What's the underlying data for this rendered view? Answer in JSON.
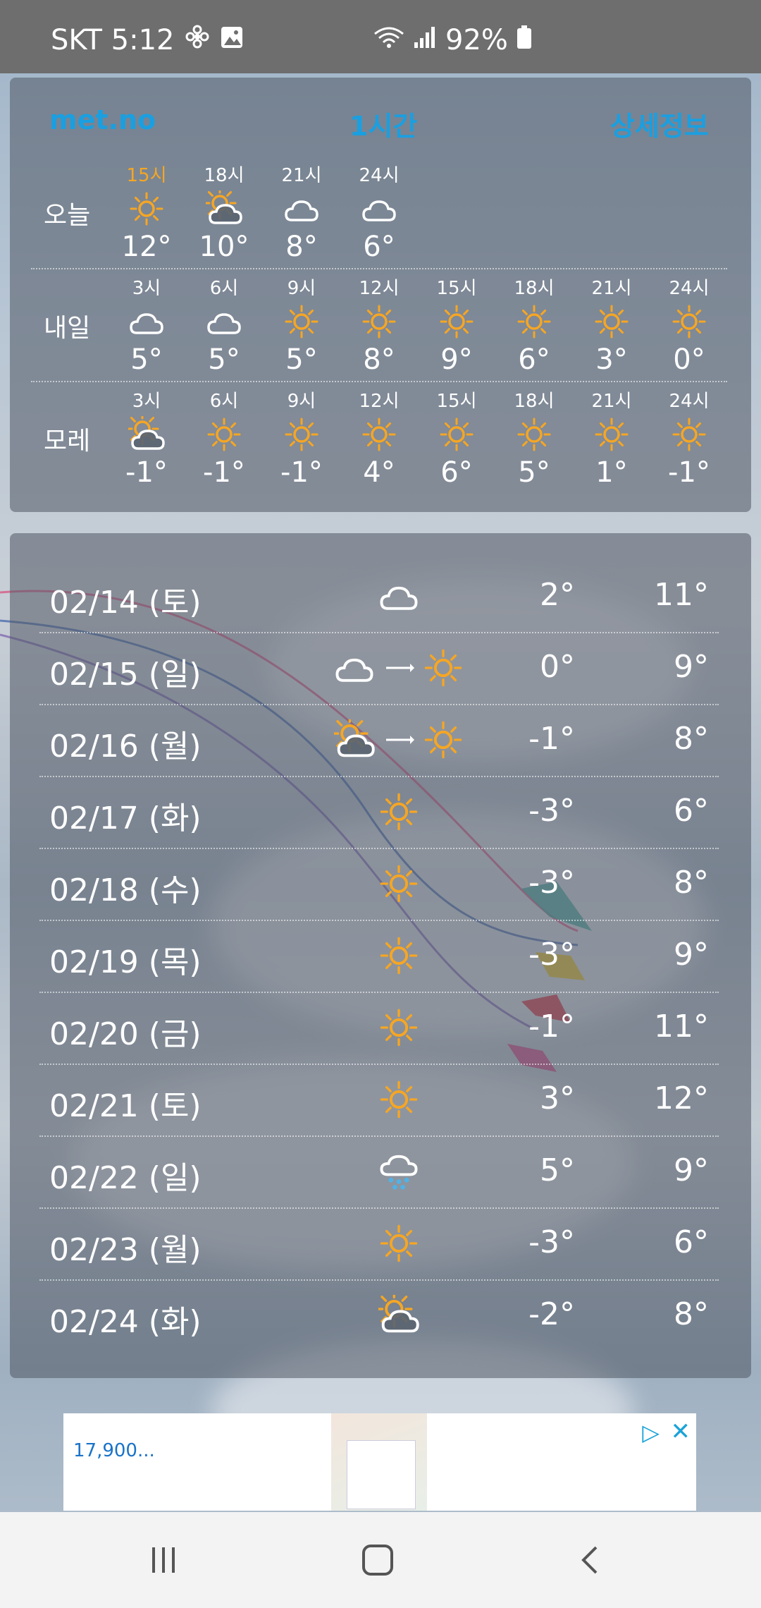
{
  "status_bar": {
    "carrier_time": "SKT 5:12",
    "battery": "92%",
    "icons": [
      "fan-icon",
      "gallery-icon",
      "wifi-icon",
      "signal-icon",
      "battery-icon"
    ]
  },
  "header": {
    "source_link": "met.no",
    "interval_label": "1시간",
    "detail_link": "상세정보"
  },
  "hourly": {
    "rows": [
      {
        "label": "오늘",
        "slots": [
          {
            "time": "15시",
            "icon": "sun-icon",
            "temp": "12°",
            "highlight": true
          },
          {
            "time": "18시",
            "icon": "partly-cloudy-icon",
            "temp": "10°"
          },
          {
            "time": "21시",
            "icon": "cloud-icon",
            "temp": "8°"
          },
          {
            "time": "24시",
            "icon": "cloud-icon",
            "temp": "6°"
          }
        ]
      },
      {
        "label": "내일",
        "slots": [
          {
            "time": "3시",
            "icon": "cloud-icon",
            "temp": "5°"
          },
          {
            "time": "6시",
            "icon": "cloud-icon",
            "temp": "5°"
          },
          {
            "time": "9시",
            "icon": "sun-icon",
            "temp": "5°"
          },
          {
            "time": "12시",
            "icon": "sun-icon",
            "temp": "8°"
          },
          {
            "time": "15시",
            "icon": "sun-icon",
            "temp": "9°"
          },
          {
            "time": "18시",
            "icon": "sun-icon",
            "temp": "6°"
          },
          {
            "time": "21시",
            "icon": "sun-icon",
            "temp": "3°"
          },
          {
            "time": "24시",
            "icon": "sun-icon",
            "temp": "0°"
          }
        ]
      },
      {
        "label": "모레",
        "slots": [
          {
            "time": "3시",
            "icon": "partly-cloudy-icon",
            "temp": "-1°"
          },
          {
            "time": "6시",
            "icon": "sun-icon",
            "temp": "-1°"
          },
          {
            "time": "9시",
            "icon": "sun-icon",
            "temp": "-1°"
          },
          {
            "time": "12시",
            "icon": "sun-icon",
            "temp": "4°"
          },
          {
            "time": "15시",
            "icon": "sun-icon",
            "temp": "6°"
          },
          {
            "time": "18시",
            "icon": "sun-icon",
            "temp": "5°"
          },
          {
            "time": "21시",
            "icon": "sun-icon",
            "temp": "1°"
          },
          {
            "time": "24시",
            "icon": "sun-icon",
            "temp": "-1°"
          }
        ]
      }
    ]
  },
  "daily": [
    {
      "date": "02/14 (토)",
      "icons": [
        "cloud-icon"
      ],
      "low": "2°",
      "high": "11°"
    },
    {
      "date": "02/15 (일)",
      "icons": [
        "cloud-icon",
        "arrow-right-icon",
        "sun-icon"
      ],
      "low": "0°",
      "high": "9°"
    },
    {
      "date": "02/16 (월)",
      "icons": [
        "partly-cloudy-icon",
        "arrow-right-icon",
        "sun-icon"
      ],
      "low": "-1°",
      "high": "8°"
    },
    {
      "date": "02/17 (화)",
      "icons": [
        "sun-icon"
      ],
      "low": "-3°",
      "high": "6°"
    },
    {
      "date": "02/18 (수)",
      "icons": [
        "sun-icon"
      ],
      "low": "-3°",
      "high": "8°"
    },
    {
      "date": "02/19 (목)",
      "icons": [
        "sun-icon"
      ],
      "low": "-3°",
      "high": "9°"
    },
    {
      "date": "02/20 (금)",
      "icons": [
        "sun-icon"
      ],
      "low": "-1°",
      "high": "11°"
    },
    {
      "date": "02/21 (토)",
      "icons": [
        "sun-icon"
      ],
      "low": "3°",
      "high": "12°"
    },
    {
      "date": "02/22 (일)",
      "icons": [
        "rain-icon"
      ],
      "low": "5°",
      "high": "9°"
    },
    {
      "date": "02/23 (월)",
      "icons": [
        "sun-icon"
      ],
      "low": "-3°",
      "high": "6°"
    },
    {
      "date": "02/24 (화)",
      "icons": [
        "partly-cloudy-icon"
      ],
      "low": "-2°",
      "high": "8°"
    }
  ],
  "ad": {
    "price": "17,900...",
    "close_icon": "close-icon",
    "info_icon": "ad-info-icon"
  },
  "nav_bar": {
    "buttons": [
      "recent-apps-icon",
      "home-icon",
      "back-icon"
    ]
  },
  "colors": {
    "accent_link": "#1a9fe0",
    "sun": "#f6a623",
    "rain": "#4fb3e8"
  }
}
